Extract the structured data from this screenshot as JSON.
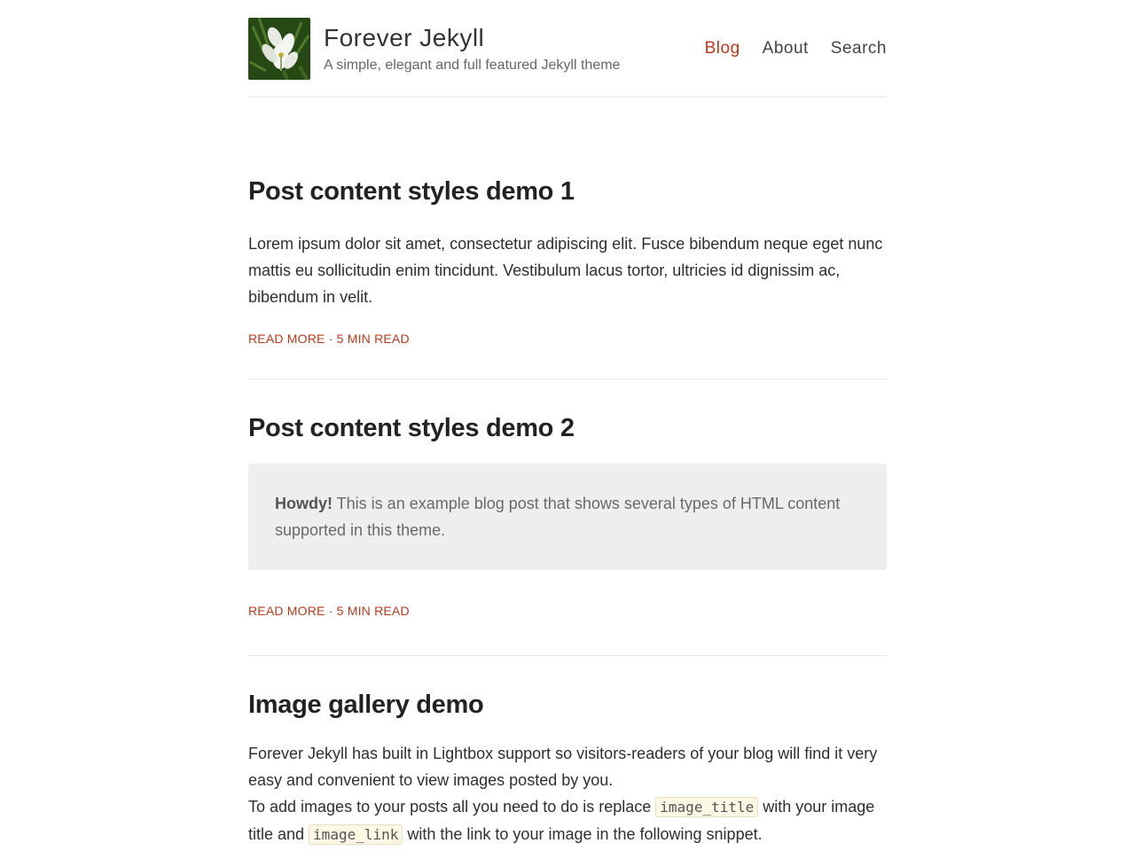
{
  "site": {
    "title": "Forever Jekyll",
    "tagline": "A simple, elegant and full featured Jekyll theme",
    "logo_icon": "white-lily-flower-image"
  },
  "nav": [
    {
      "label": "Blog",
      "active": true
    },
    {
      "label": "About",
      "active": false
    },
    {
      "label": "Search",
      "active": false
    }
  ],
  "posts": [
    {
      "title": "Post content styles demo 1",
      "excerpt": "Lorem ipsum dolor sit amet, consectetur adipiscing elit. Fusce bibendum neque eget nunc mattis eu sollicitudin enim tincidunt. Vestibulum lacus tortor, ultricies id dignissim ac, bibendum in velit.",
      "read_more": "Read more",
      "separator": "·",
      "read_time": "5 min read"
    },
    {
      "title": "Post content styles demo 2",
      "notice_bold": "Howdy!",
      "notice_text": " This is an example blog post that shows several types of HTML content supported in this theme.",
      "read_more": "Read more",
      "separator": "·",
      "read_time": "5 min read"
    },
    {
      "title": "Image gallery demo",
      "para1": "Forever Jekyll has built in Lightbox support so visitors-readers of your blog will find it very easy and convenient to view images posted by you.",
      "para2_a": "To add images to your posts all you need to do is replace ",
      "code1": "image_title",
      "para2_b": " with your image title and ",
      "code2": "image_link",
      "para2_c": " with the link to your image in the following snippet."
    }
  ],
  "colors": {
    "accent": "#b73a1f",
    "notice_bg": "#eeeeee",
    "divider": "#e8e8e8"
  }
}
